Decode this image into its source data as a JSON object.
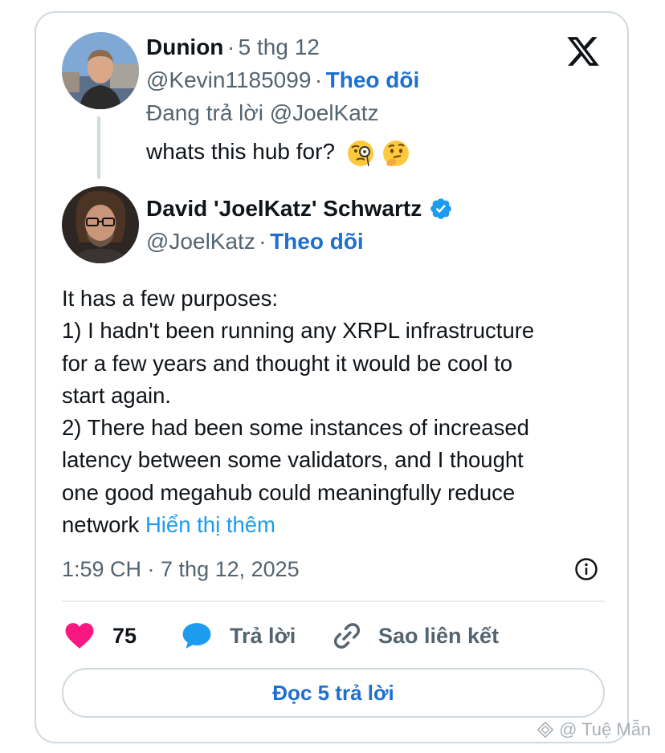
{
  "reply_to_tweet": {
    "author_name": "Dunion",
    "separator": "·",
    "date": "5 thg 12",
    "handle": "@Kevin1185099",
    "follow_label": "Theo dõi",
    "replying_to": "Đang trả lời @JoelKatz",
    "text": "whats this hub for?",
    "emojis": [
      "monocle-face-emoji",
      "thinking-face-emoji"
    ]
  },
  "main_tweet": {
    "author_name": "David 'JoelKatz' Schwartz",
    "verified": true,
    "handle": "@JoelKatz",
    "follow_label": "Theo dõi",
    "text_lines": [
      "It has a few purposes:",
      "1) I hadn't been running any XRPL infrastructure",
      "for a few years and thought it would be cool to",
      "start again.",
      "2) There had been some instances of increased",
      "latency between some validators, and I thought",
      "one good megahub could meaningfully reduce",
      "network"
    ],
    "show_more_label": "Hiển thị thêm",
    "timestamp": "1:59 CH · 7 thg 12, 2025"
  },
  "actions": {
    "like_count": "75",
    "reply_label": "Trả lời",
    "copy_link_label": "Sao liên kết"
  },
  "read_replies_label": "Đọc 5 trả lời",
  "watermark": "@ Tuệ Mẫn",
  "icons": {
    "platform": "x-logo-icon",
    "verified": "verified-badge-icon",
    "info": "info-icon",
    "like": "heart-icon",
    "reply": "speech-bubble-icon",
    "link": "link-icon"
  },
  "colors": {
    "follow": "#1d6fd1",
    "show_more": "#1d9bf0",
    "heart": "#f91880",
    "reply_bubble": "#1d9bf0",
    "verified": "#1d9bf0",
    "muted": "#536471",
    "border": "#cfd9de"
  }
}
